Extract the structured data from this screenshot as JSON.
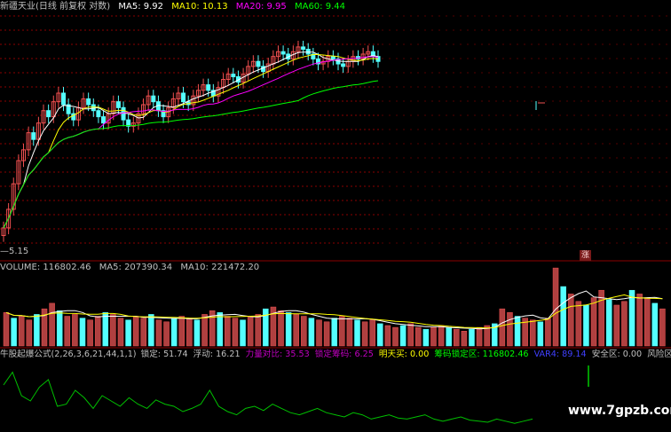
{
  "colors": {
    "background": "#000000",
    "grid": "#8b0000",
    "up": "#f05050",
    "down": "#54ffff",
    "ma5": "#ffffff",
    "ma10": "#ffff00",
    "ma20": "#ff00ff",
    "ma60": "#00ff00",
    "indicator_line": "#00c000"
  },
  "price_legend": {
    "stock": "新疆天业(日线 前复权 对数)",
    "ma5": "MA5: 9.92",
    "ma10": "MA10: 10.13",
    "ma20": "MA20: 9.95",
    "ma60": "MA60: 9.44"
  },
  "low_label": "—5.15",
  "badge": "涨",
  "volume_legend": {
    "volume": "VOLUME: 116802.46",
    "ma5": "MA5: 207390.34",
    "ma10": "MA10: 221472.20"
  },
  "indicator_legend": {
    "name": "牛股起爆公式(2,26,3,6,21,44,1,1)",
    "lock": "锁定: 51.74",
    "float": "浮动: 16.21",
    "power": "力量对比: 35.53",
    "lockchip": "锁定筹码: 6.25",
    "tomorrow": "明天买: 0.00",
    "chiplock": "筹码锁定区: 116802.46",
    "var4": "VAR4: 89.14",
    "safe": "安全区: 0.00",
    "risk": "风险区: 60.00"
  },
  "watermark": "www.7gpzb.com",
  "chart_data": [
    {
      "type": "candlestick",
      "title": "新疆天业(日线 前复权 对数)",
      "low_marker": 5.15,
      "close": [
        5.2,
        5.6,
        6.2,
        6.8,
        7.1,
        7.6,
        7.4,
        7.9,
        8.3,
        8.1,
        8.6,
        8.9,
        8.5,
        8.2,
        8.0,
        8.4,
        8.7,
        8.5,
        8.3,
        8.1,
        7.9,
        8.2,
        8.6,
        8.4,
        8.0,
        7.8,
        7.9,
        8.2,
        8.5,
        8.8,
        8.6,
        8.3,
        8.1,
        8.4,
        8.7,
        8.9,
        8.6,
        8.5,
        8.8,
        9.0,
        9.2,
        9.0,
        8.8,
        9.1,
        9.4,
        9.6,
        9.5,
        9.3,
        9.6,
        9.9,
        10.1,
        9.9,
        9.7,
        10.0,
        10.3,
        10.5,
        10.4,
        10.2,
        10.5,
        10.7,
        10.6,
        10.4,
        10.2,
        10.0,
        10.1,
        10.3,
        10.2,
        10.0,
        9.9,
        10.1,
        10.3,
        10.2,
        10.4,
        10.5,
        10.3,
        10.1
      ]
    },
    {
      "type": "bar",
      "title": "VOLUME",
      "values": [
        180,
        150,
        160,
        140,
        170,
        200,
        230,
        190,
        160,
        170,
        150,
        140,
        160,
        180,
        170,
        150,
        140,
        160,
        150,
        170,
        140,
        130,
        150,
        160,
        150,
        140,
        170,
        190,
        180,
        160,
        150,
        140,
        160,
        170,
        200,
        210,
        190,
        180,
        170,
        160,
        150,
        140,
        130,
        150,
        160,
        150,
        140,
        130,
        140,
        120,
        110,
        100,
        110,
        120,
        100,
        90,
        100,
        110,
        100,
        90,
        80,
        90,
        100,
        110,
        120,
        200,
        180,
        160,
        150,
        140,
        130,
        150,
        420,
        320,
        280,
        240,
        220,
        260,
        300,
        250,
        220,
        240,
        300,
        280,
        260,
        230,
        200
      ]
    },
    {
      "type": "line",
      "title": "牛股起爆公式",
      "values": [
        40,
        52,
        30,
        25,
        38,
        45,
        20,
        22,
        35,
        28,
        18,
        30,
        25,
        20,
        28,
        22,
        18,
        26,
        22,
        20,
        15,
        18,
        22,
        35,
        20,
        15,
        12,
        18,
        20,
        16,
        22,
        18,
        14,
        12,
        15,
        18,
        14,
        12,
        10,
        14,
        12,
        8,
        10,
        12,
        9,
        8,
        10,
        12,
        8,
        6,
        8,
        10,
        7,
        6,
        5,
        8,
        6,
        4,
        6,
        8
      ]
    }
  ]
}
